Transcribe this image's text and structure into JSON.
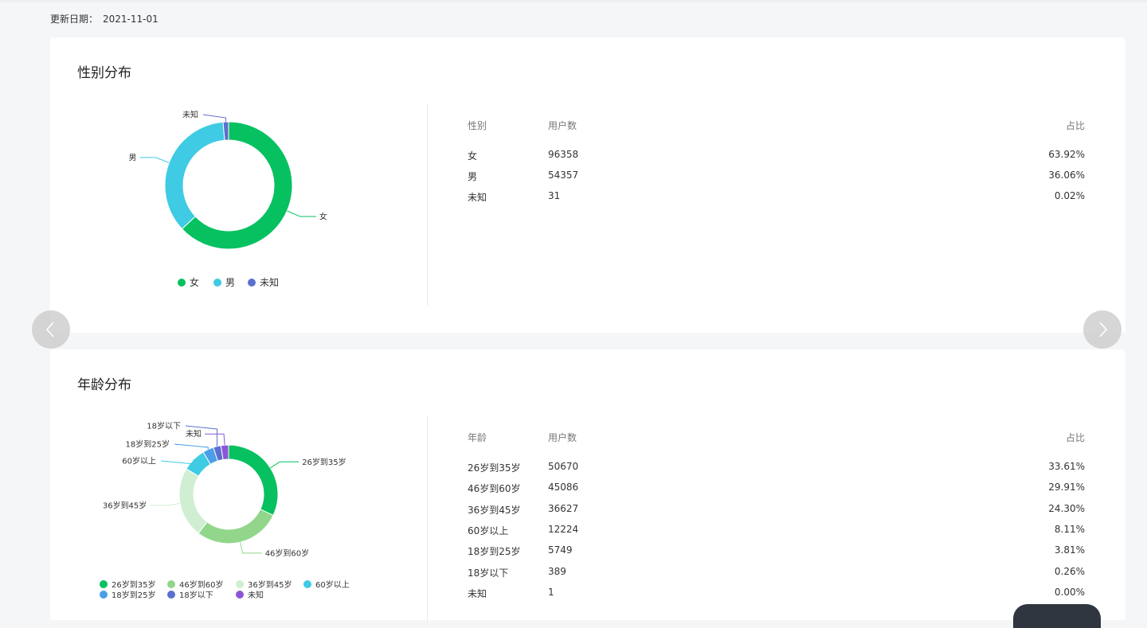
{
  "header": {
    "update_label": "更新日期：",
    "update_date": "2021-11-01"
  },
  "gender": {
    "title": "性别分布",
    "table_headers": {
      "col1": "性别",
      "col2": "用户数",
      "col3": "占比"
    },
    "rows": [
      {
        "label": "女",
        "users": "96358",
        "ratio": "63.92%"
      },
      {
        "label": "男",
        "users": "54357",
        "ratio": "36.06%"
      },
      {
        "label": "未知",
        "users": "31",
        "ratio": "0.02%"
      }
    ],
    "legend": [
      "女",
      "男",
      "未知"
    ]
  },
  "age": {
    "title": "年龄分布",
    "table_headers": {
      "col1": "年龄",
      "col2": "用户数",
      "col3": "占比"
    },
    "rows": [
      {
        "label": "26岁到35岁",
        "users": "50670",
        "ratio": "33.61%"
      },
      {
        "label": "46岁到60岁",
        "users": "45086",
        "ratio": "29.91%"
      },
      {
        "label": "36岁到45岁",
        "users": "36627",
        "ratio": "24.30%"
      },
      {
        "label": "60岁以上",
        "users": "12224",
        "ratio": "8.11%"
      },
      {
        "label": "18岁到25岁",
        "users": "5749",
        "ratio": "3.81%"
      },
      {
        "label": "18岁以下",
        "users": "389",
        "ratio": "0.26%"
      },
      {
        "label": "未知",
        "users": "1",
        "ratio": "0.00%"
      }
    ],
    "legend": [
      "26岁到35岁",
      "46岁到60岁",
      "36岁到45岁",
      "60岁以上",
      "18岁到25岁",
      "18岁以下",
      "未知"
    ]
  },
  "colors": {
    "green": "#07c160",
    "cyan": "#3ecbe3",
    "indigo": "#5b6fcf",
    "light_green": "#91d68b",
    "pale_green": "#cfeed2",
    "blue": "#4a9ee8",
    "purple": "#8a56d6"
  },
  "chart_data": [
    {
      "type": "pie",
      "variant": "donut",
      "categories": [
        "女",
        "男",
        "未知"
      ],
      "values": [
        96358,
        54357,
        31
      ],
      "colors": [
        "#07c160",
        "#3ecbe3",
        "#5b6fcf"
      ],
      "legend_position": "bottom"
    },
    {
      "type": "pie",
      "variant": "donut",
      "categories": [
        "26岁到35岁",
        "46岁到60岁",
        "36岁到45岁",
        "60岁以上",
        "18岁到25岁",
        "18岁以下",
        "未知"
      ],
      "values": [
        50670,
        45086,
        36627,
        12224,
        5749,
        389,
        1
      ],
      "colors": [
        "#07c160",
        "#91d68b",
        "#cfeed2",
        "#3ecbe3",
        "#4a9ee8",
        "#5b6fcf",
        "#8a56d6"
      ],
      "legend_position": "bottom"
    }
  ]
}
